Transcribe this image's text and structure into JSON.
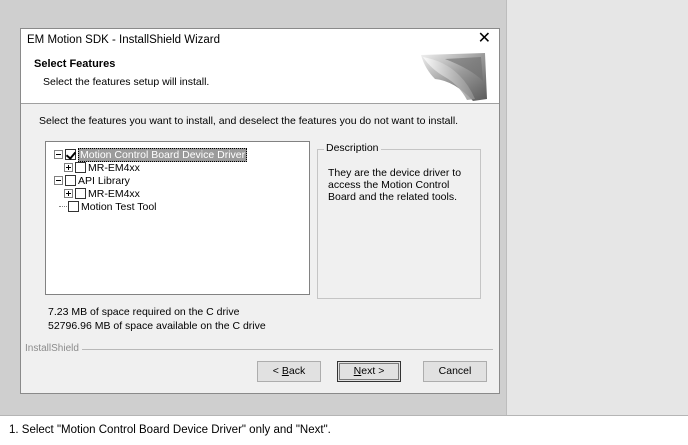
{
  "window": {
    "title": "EM Motion SDK - InstallShield Wizard",
    "close_glyph": "✕"
  },
  "header": {
    "title": "Select Features",
    "subtitle": "Select the features setup will install."
  },
  "instruction": "Select the features you want to install, and deselect the features you do not want to install.",
  "tree": {
    "items": [
      {
        "label": "Motion Control Board Device Driver",
        "level": 0,
        "expander": "minus",
        "checked": true,
        "selected": true
      },
      {
        "label": "MR-EM4xx",
        "level": 1,
        "expander": "plus",
        "checked": false,
        "selected": false
      },
      {
        "label": "API Library",
        "level": 0,
        "expander": "minus",
        "checked": false,
        "selected": false
      },
      {
        "label": "MR-EM4xx",
        "level": 1,
        "expander": "plus",
        "checked": false,
        "selected": false
      },
      {
        "label": "Motion Test Tool",
        "level": 0,
        "expander": "none",
        "checked": false,
        "selected": false
      }
    ]
  },
  "description": {
    "legend": "Description",
    "text": "They are the device driver to access the Motion Control Board and the related tools."
  },
  "space": {
    "required": "7.23 MB of space required on the C drive",
    "available": "52796.96 MB of space available on the C drive"
  },
  "footer": {
    "brand": "InstallShield"
  },
  "buttons": {
    "back_prefix": "< ",
    "back_key": "B",
    "back_rest": "ack",
    "next_key": "N",
    "next_rest": "ext >",
    "cancel": "Cancel"
  },
  "caption": "1.  Select \"Motion Control Board Device Driver\" only and \"Next\"."
}
